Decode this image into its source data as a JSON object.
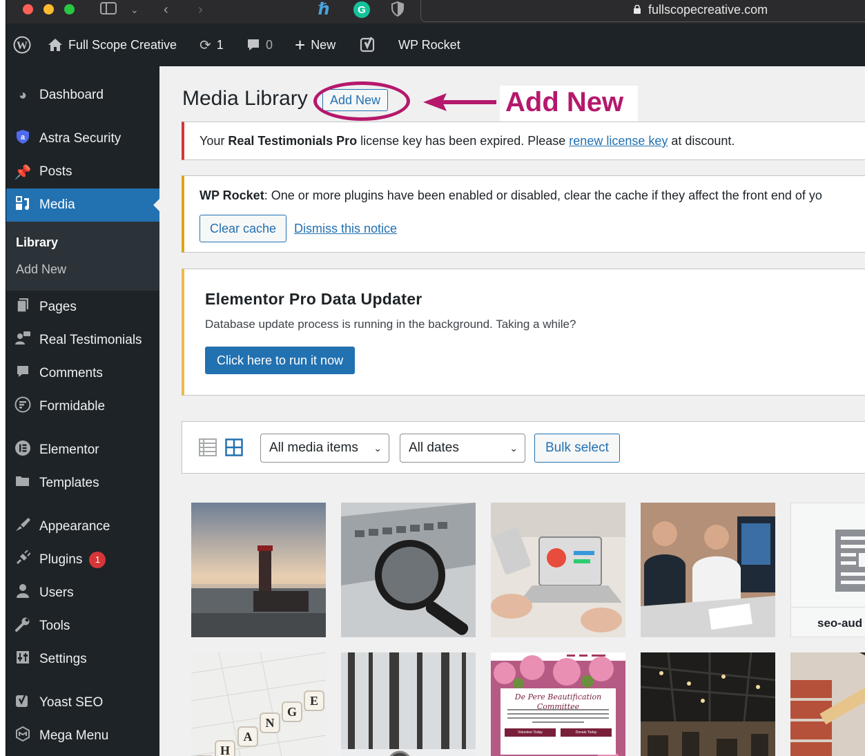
{
  "browser": {
    "url": "fullscopecreative.com"
  },
  "admin_bar": {
    "site_name": "Full Scope Creative",
    "updates_count": "1",
    "comments_count": "0",
    "new_label": "New",
    "wp_rocket_label": "WP Rocket"
  },
  "sidebar": {
    "dashboard": "Dashboard",
    "astra_security": "Astra Security",
    "posts": "Posts",
    "media": "Media",
    "library": "Library",
    "add_new": "Add New",
    "pages": "Pages",
    "real_testimonials": "Real Testimonials",
    "comments": "Comments",
    "formidable": "Formidable",
    "elementor": "Elementor",
    "templates": "Templates",
    "appearance": "Appearance",
    "plugins": "Plugins",
    "plugins_badge": "1",
    "users": "Users",
    "tools": "Tools",
    "settings": "Settings",
    "yoast_seo": "Yoast SEO",
    "mega_menu": "Mega Menu"
  },
  "header": {
    "title": "Media Library",
    "add_new_button": "Add New",
    "annotation": "Add New"
  },
  "notices": {
    "license": {
      "prefix": "Your ",
      "plugin": "Real Testimonials Pro",
      "middle": " license key has been expired. Please ",
      "link": "renew license key",
      "suffix": " at discount."
    },
    "rocket": {
      "label": "WP Rocket",
      "text": ": One or more plugins have been enabled or disabled, clear the cache if they affect the front end of yo",
      "clear_cache": "Clear cache",
      "dismiss": "Dismiss this notice"
    },
    "elementor": {
      "title": "Elementor Pro Data Updater",
      "description": "Database update process is running in the background. Taking a while?",
      "button": "Click here to run it now"
    }
  },
  "media_toolbar": {
    "type_filter": "All media items",
    "date_filter": "All dates",
    "bulk_select": "Bulk select"
  },
  "media_items": {
    "seo_filename": "seo-aud",
    "thumb7_heading": "De Pere Beautification Committee",
    "thumb7_btn1": "Volunteer Today",
    "thumb7_btn2": "Donate Today"
  },
  "colors": {
    "admin_dark": "#1d2327",
    "accent_blue": "#2271b1",
    "annotation_magenta": "#b5186b",
    "error_red": "#d63638",
    "warning_yellow": "#dba617"
  }
}
